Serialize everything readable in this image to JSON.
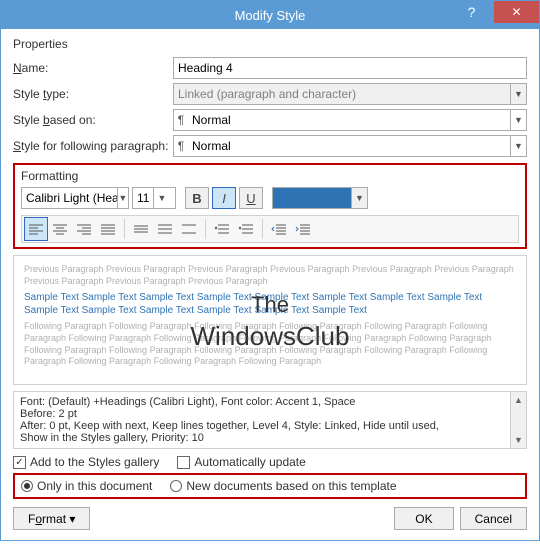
{
  "titlebar": {
    "title": "Modify Style"
  },
  "properties": {
    "section": "Properties",
    "name_label": "Name:",
    "name_value": "Heading 4",
    "type_label": "Style type:",
    "type_value": "Linked (paragraph and character)",
    "based_label": "Style based on:",
    "based_value": "Normal",
    "following_label": "Style for following paragraph:",
    "following_value": "Normal"
  },
  "pilcrow": "¶",
  "formatting": {
    "section": "Formatting",
    "font": "Calibri Light (Headings)",
    "size": "11",
    "bold": "B",
    "italic": "I",
    "underline": "U",
    "color": "#2e74b5"
  },
  "preview": {
    "prev": "Previous Paragraph Previous Paragraph Previous Paragraph Previous Paragraph Previous Paragraph Previous Paragraph Previous Paragraph Previous Paragraph Previous Paragraph",
    "sample": "Sample Text Sample Text Sample Text Sample Text Sample Text Sample Text Sample Text Sample Text Sample Text Sample Text Sample Text Sample Text Sample Text Sample Text",
    "next": "Following Paragraph Following Paragraph Following Paragraph Following Paragraph Following Paragraph Following Paragraph Following Paragraph Following Paragraph Following Paragraph Following Paragraph Following Paragraph Following Paragraph Following Paragraph Following Paragraph Following Paragraph Following Paragraph Following Paragraph Following Paragraph Following Paragraph Following Paragraph"
  },
  "watermark": {
    "line1": "The",
    "line2": "WindowsClub"
  },
  "info": {
    "line1": "Font: (Default) +Headings (Calibri Light), Font color: Accent 1, Space",
    "line2": "    Before:  2 pt",
    "line3": "    After:   0 pt, Keep with next, Keep lines together, Level 4, Style: Linked, Hide until used,",
    "line4": "Show in the Styles gallery, Priority: 10"
  },
  "checks": {
    "gallery": "Add to the Styles gallery",
    "auto": "Automatically update"
  },
  "radios": {
    "doc": "Only in this document",
    "tpl": "New documents based on this template"
  },
  "buttons": {
    "format": "Format ▾",
    "ok": "OK",
    "cancel": "Cancel"
  }
}
